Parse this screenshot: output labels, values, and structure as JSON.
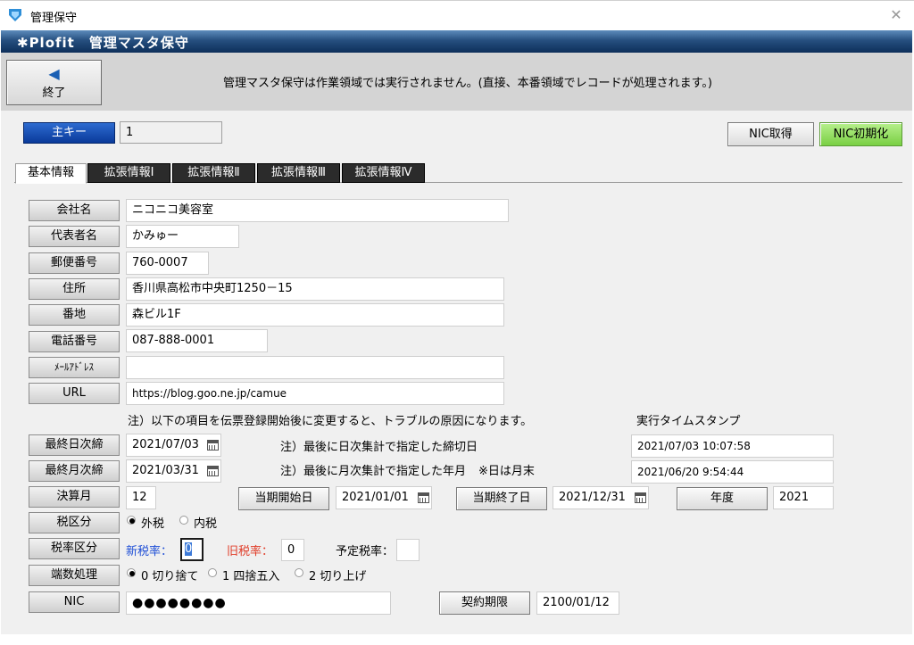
{
  "window": {
    "title": "管理保守"
  },
  "banner": {
    "title": "✱Plofit　管理マスタ保守"
  },
  "toolbar": {
    "exit_label": "終了",
    "notice": "管理マスタ保守は作業領域では実行されません。(直接、本番領域でレコードが処理されます。)"
  },
  "primary_key": {
    "label": "主キー",
    "value": "1"
  },
  "actions": {
    "nic_get": "NIC取得",
    "nic_init": "NIC初期化"
  },
  "tabs": [
    "基本情報",
    "拡張情報Ⅰ",
    "拡張情報Ⅱ",
    "拡張情報Ⅲ",
    "拡張情報Ⅳ"
  ],
  "form": {
    "company": {
      "label": "会社名",
      "value": "ニコニコ美容室"
    },
    "representative": {
      "label": "代表者名",
      "value": "かみゅー"
    },
    "postal": {
      "label": "郵便番号",
      "value": "760-0007"
    },
    "address": {
      "label": "住所",
      "value": "香川県高松市中央町1250－15"
    },
    "address2": {
      "label": "番地",
      "value": "森ビル1F"
    },
    "phone": {
      "label": "電話番号",
      "value": "087-888-0001"
    },
    "email": {
      "label": "ﾒｰﾙｱﾄﾞﾚｽ",
      "value": ""
    },
    "url": {
      "label": "URL",
      "value": "https://blog.goo.ne.jp/camue"
    }
  },
  "note_main": "注）以下の項目を伝票登録開始後に変更すると、トラブルの原因になります。",
  "timestamp_heading": "実行タイムスタンプ",
  "closing": {
    "daily": {
      "label": "最終日次締",
      "value": "2021/07/03",
      "note": "注）最後に日次集計で指定した締切日",
      "timestamp": "2021/07/03 10:07:58"
    },
    "monthly": {
      "label": "最終月次締",
      "value": "2021/03/31",
      "note": "注）最後に月次集計で指定した年月",
      "note2": "※日は月末",
      "timestamp": "2021/06/20 9:54:44"
    }
  },
  "fiscal": {
    "label": "決算月",
    "value": "12",
    "start_label": "当期開始日",
    "start_value": "2021/01/01",
    "end_label": "当期終了日",
    "end_value": "2021/12/31",
    "year_label": "年度",
    "year_value": "2021"
  },
  "tax_type": {
    "label": "税区分",
    "options": [
      "外税",
      "内税"
    ],
    "selected": "外税"
  },
  "tax_rate": {
    "label": "税率区分",
    "new_label": "新税率：",
    "new_value": "0",
    "old_label": "旧税率：",
    "old_value": "0",
    "planned_label": "予定税率：",
    "planned_value": "",
    "new_color": "#1f4fd6",
    "old_color": "#e03c28"
  },
  "rounding": {
    "label": "端数処理",
    "options": [
      "0 切り捨て",
      "1 四捨五入",
      "2 切り上げ"
    ],
    "selected": "0 切り捨て"
  },
  "nic": {
    "label": "NIC",
    "value": "●●●●●●●●"
  },
  "contract": {
    "label": "契約期限",
    "value": "2100/01/12"
  }
}
